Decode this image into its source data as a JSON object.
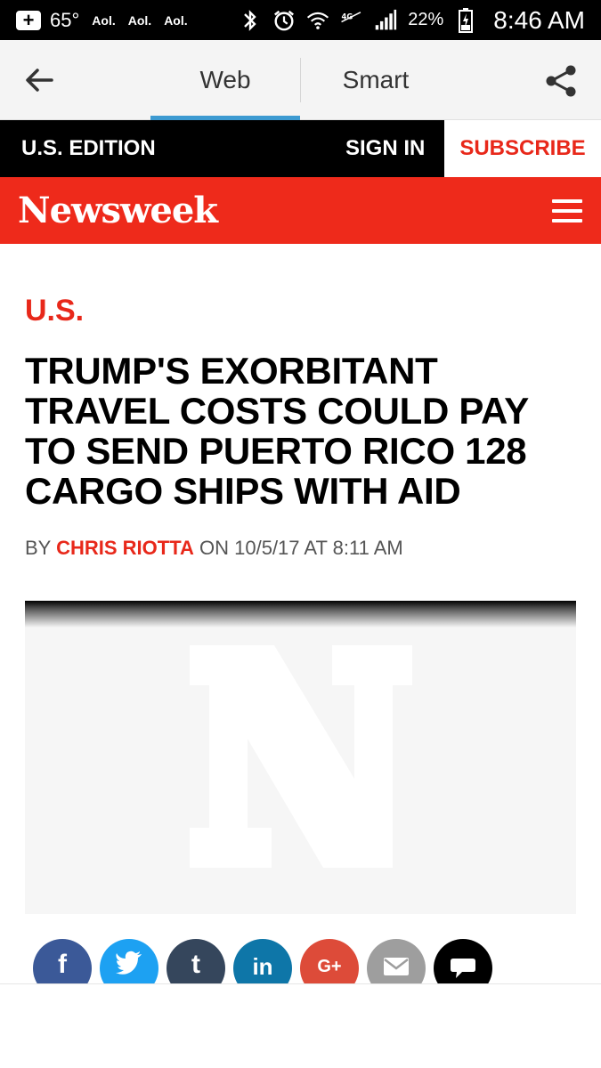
{
  "status_bar": {
    "temperature": "65°",
    "notifications": [
      "Aol.",
      "Aol.",
      "Aol."
    ],
    "battery_percent": "22%",
    "time": "8:46 AM",
    "icons": [
      "add-icon",
      "bluetooth-icon",
      "alarm-icon",
      "wifi-icon",
      "lte-icon",
      "signal-icon",
      "battery-charging-icon"
    ]
  },
  "toolbar": {
    "tabs": [
      {
        "label": "Web",
        "active": true
      },
      {
        "label": "Smart",
        "active": false
      }
    ],
    "active_color": "#3d9ad1",
    "icons": [
      "back-arrow-icon",
      "share-icon"
    ]
  },
  "edition_bar": {
    "edition_label": "U.S. EDITION",
    "sign_in_label": "SIGN IN",
    "subscribe_label": "SUBSCRIBE"
  },
  "brand": {
    "logo_text": "Newsweek",
    "color": "#ee2a1b",
    "menu_icon": "hamburger-menu-icon"
  },
  "article": {
    "section": "U.S.",
    "headline": "TRUMP'S EXORBITANT TRAVEL COSTS COULD PAY TO SEND PUERTO RICO 128 CARGO SHIPS WITH AID",
    "byline_prefix": "BY",
    "author": "CHRIS RIOTTA",
    "byline_on": "ON 10/5/17 AT 8:11 AM",
    "image_placeholder": "N"
  },
  "share_buttons": [
    {
      "icon": "facebook-icon",
      "glyph": "f",
      "color": "#3b5998"
    },
    {
      "icon": "twitter-icon",
      "glyph": "",
      "color": "#1da1f2"
    },
    {
      "icon": "tumblr-icon",
      "glyph": "t",
      "color": "#35465c"
    },
    {
      "icon": "linkedin-icon",
      "glyph": "in",
      "color": "#0e76a8"
    },
    {
      "icon": "google-plus-icon",
      "glyph": "G+",
      "color": "#dd4b39"
    },
    {
      "icon": "email-icon",
      "glyph": "",
      "color": "#9e9e9e"
    },
    {
      "icon": "comment-icon",
      "glyph": "",
      "color": "#000000"
    }
  ]
}
